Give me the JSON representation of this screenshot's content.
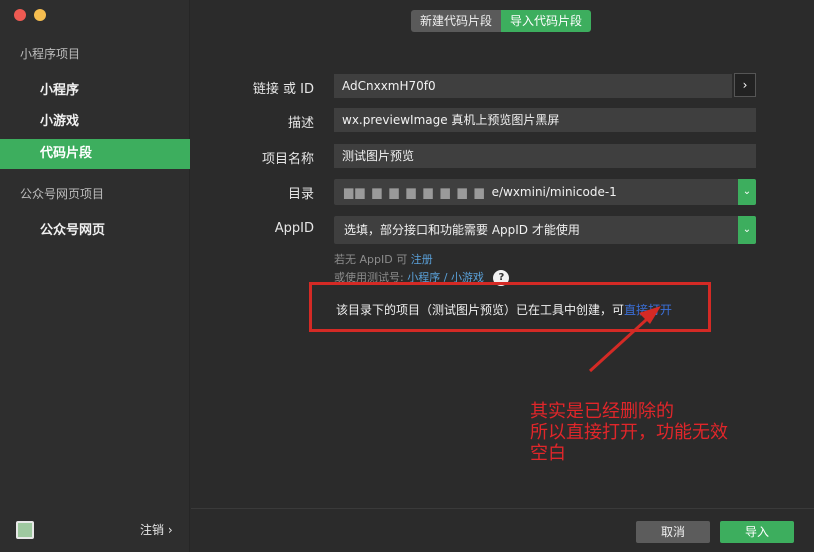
{
  "sidebar": {
    "section1": "小程序项目",
    "items1": [
      "小程序",
      "小游戏",
      "代码片段"
    ],
    "section2": "公众号网页项目",
    "items2": [
      "公众号网页"
    ],
    "logout": "注销 ›"
  },
  "tabs": {
    "new": "新建代码片段",
    "import": "导入代码片段"
  },
  "form": {
    "link_label": "链接 或 ID",
    "link_value": "AdCnxxmH70f0",
    "desc_label": "描述",
    "desc_value": "wx.previewImage 真机上预览图片黑屏",
    "name_label": "项目名称",
    "name_value": "测试图片预览",
    "dir_label": "目录",
    "dir_value": "e/wxmini/minicode-1",
    "appid_label": "AppID",
    "appid_placeholder": "选填，部分接口和功能需要 AppID 才能使用"
  },
  "hints": {
    "no_appid": "若无 AppID 可",
    "register": "注册",
    "test_prefix": "或使用测试号:",
    "test_mini": "小程序",
    "sep": "/",
    "test_game": "小游戏",
    "help": "?"
  },
  "notice": {
    "text": "该目录下的项目（测试图片预览）已在工具中创建，可",
    "link": "直接打开"
  },
  "annotation": [
    "其实是已经删除的",
    "所以直接打开，功能无效",
    "空白"
  ],
  "footer": {
    "cancel": "取消",
    "ok": "导入"
  },
  "colors": {
    "accent": "#3dae5e",
    "annotation_red": "#d42a25",
    "link": "#3b6fd8"
  }
}
